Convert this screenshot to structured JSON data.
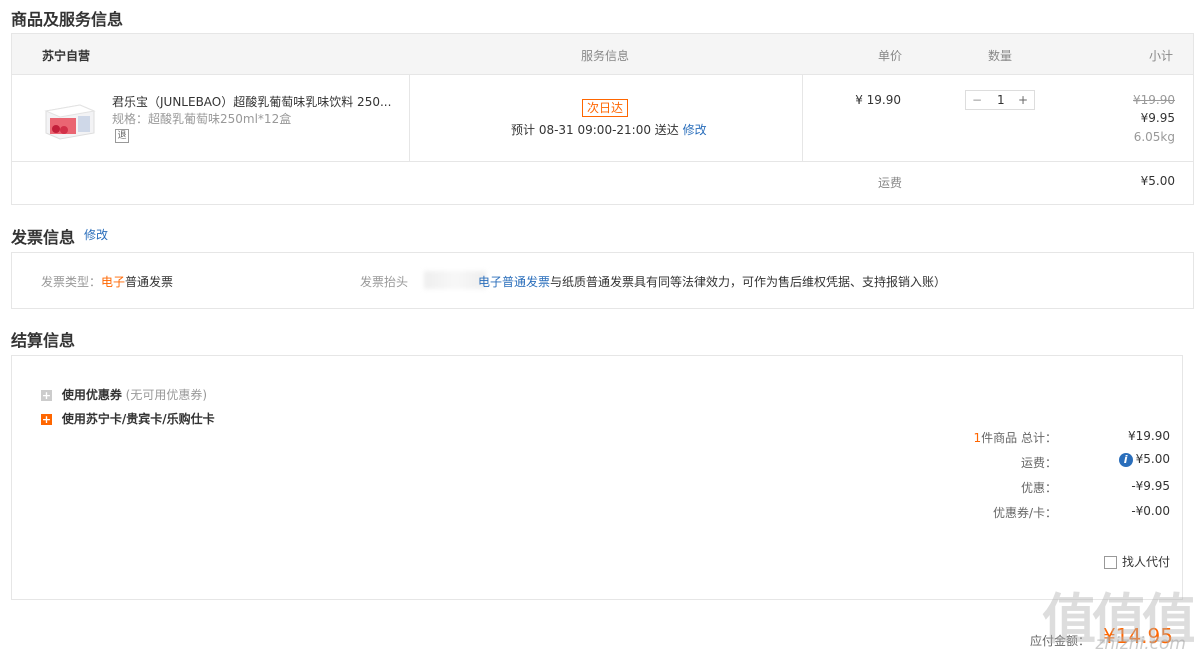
{
  "goods": {
    "section_title": "商品及服务信息",
    "header": {
      "store": "苏宁自营",
      "service": "服务信息",
      "unit_price": "单价",
      "quantity": "数量",
      "subtotal": "小计"
    },
    "item": {
      "name": "君乐宝（JUNLEBAO）超酸乳葡萄味乳味饮料 250...",
      "spec": "规格：超酸乳葡萄味250ml*12盒",
      "return_badge": "退",
      "next_day_tag": "次日达",
      "delivery": "预计 08-31 09:00-21:00  送达",
      "delivery_edit": "修改",
      "price": "¥ 19.90",
      "qty_minus": "−",
      "qty_value": "1",
      "qty_plus": "+",
      "original_price": "¥19.90",
      "final_price": "¥9.95",
      "weight": "6.05kg"
    },
    "shipping_label": "运费",
    "shipping_value": "¥5.00"
  },
  "invoice": {
    "section_title": "发票信息",
    "edit": "修改",
    "type_label": "发票类型：",
    "type_value_highlight": "电子",
    "type_value_rest": "普通发票",
    "header_label": "发票抬头",
    "note_link": "电子普通发票",
    "note_text": "与纸质普通发票具有同等法律效力，可作为售后维权凭据、支持报销入账）"
  },
  "settle": {
    "section_title": "结算信息",
    "coupon_label": "使用优惠券",
    "coupon_note": "(无可用优惠券)",
    "card_label": "使用苏宁卡/贵宾卡/乐购仕卡",
    "summary": {
      "count": "1",
      "count_suffix": "件商品 总计：",
      "total": "¥19.90",
      "shipping_label": "运费：",
      "shipping": "¥5.00",
      "discount_label": "优惠：",
      "discount": "-¥9.95",
      "coupon_label": "优惠券/卡：",
      "coupon": "-¥0.00"
    },
    "proxy_pay": "找人代付",
    "payable_label": "应付金额：",
    "payable": "¥14.95"
  },
  "watermark": {
    "text": "值值值",
    "url": "zhizhi.com"
  },
  "colors": {
    "accent_orange": "#ff6600",
    "link_blue": "#2a6ebb"
  }
}
